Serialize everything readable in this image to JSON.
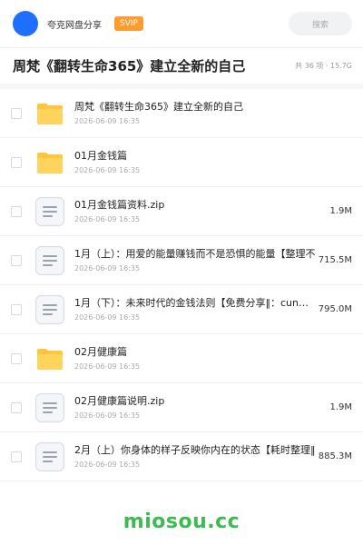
{
  "header": {
    "brand": "夸克网盘分享",
    "badge": "SVIP",
    "search_placeholder": "搜索"
  },
  "share": {
    "title": "周梵《翻转生命365》建立全新的自己",
    "meta": "共 36 项 · 15.7G"
  },
  "colors": {
    "accent": "#1f6fff",
    "badge": "#ff9c2f",
    "folder": "#ffc53d",
    "watermark": "#3dbb52"
  },
  "files": [
    {
      "name": "周梵《翻转生命365》建立全新的自己",
      "date": "2026-06-09 16:35",
      "size": "",
      "icon": "folder-icon"
    },
    {
      "name": "01月金钱篇",
      "date": "2026-06-09 16:35",
      "size": "",
      "icon": "folder-icon"
    },
    {
      "name": "01月金钱篇资料.zip",
      "date": "2026-06-09 16:35",
      "size": "1.9M",
      "icon": "document-icon"
    },
    {
      "name": "1月（上）：用爱的能量赚钱而不是恐惧的能量【整理不",
      "date": "2026-06-09 16:35",
      "size": "715.5M",
      "icon": "document-icon"
    },
    {
      "name": "1月（下）：未来时代的金钱法则【免费分享‖：cun…",
      "date": "2026-06-09 16:35",
      "size": "795.0M",
      "icon": "document-icon"
    },
    {
      "name": "02月健康篇",
      "date": "2026-06-09 16:35",
      "size": "",
      "icon": "folder-icon"
    },
    {
      "name": "02月健康篇说明.zip",
      "date": "2026-06-09 16:35",
      "size": "1.9M",
      "icon": "document-icon"
    },
    {
      "name": "2月（上）你身体的样子反映你内在的状态【耗时整理‖",
      "date": "2026-06-09 16:35",
      "size": "885.3M",
      "icon": "document-icon"
    }
  ],
  "watermark": "miosou.cc"
}
